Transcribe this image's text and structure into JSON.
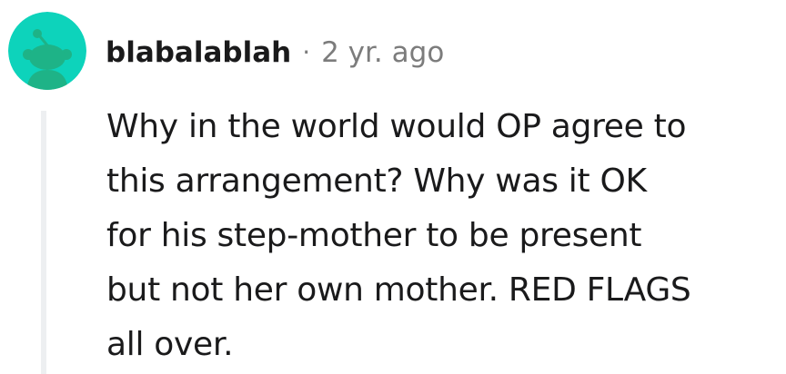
{
  "comment": {
    "author": "blabalablah",
    "separator": "·",
    "timestamp": "2 yr. ago",
    "body": "Why in the world would OP agree to\nthis arrangement? Why was it OK\nfor his step-mother to be present\nbut not her own mother. RED FLAGS\nall over.",
    "avatar_icon": "snoo-avatar-icon",
    "colors": {
      "avatar_background": "#0dd3bb",
      "avatar_figure": "#1eb387",
      "username": "#1a1a1b",
      "meta": "#7c7c7c",
      "thread_line": "#edeff1"
    }
  }
}
